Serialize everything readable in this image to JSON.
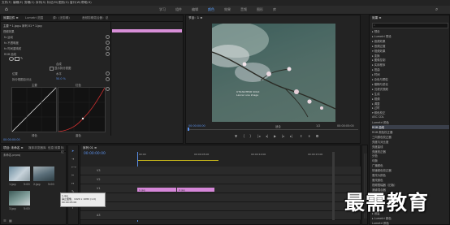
{
  "menu": [
    "文件(F)",
    "编辑(E)",
    "剪辑(C)",
    "序列(S)",
    "标记(M)",
    "图形(G)",
    "窗口(W)",
    "帮助(H)"
  ],
  "workspaces": [
    {
      "label": "学习",
      "active": false
    },
    {
      "label": "组件",
      "active": false
    },
    {
      "label": "编辑",
      "active": false
    },
    {
      "label": "颜色",
      "active": true
    },
    {
      "label": "效果",
      "active": false
    },
    {
      "label": "音频",
      "active": false
    },
    {
      "label": "图形",
      "active": false
    },
    {
      "label": "库",
      "active": false
    }
  ],
  "effect_controls": {
    "tabs": [
      "效果控件 ≡",
      "Lumetri 范围",
      "源：(无剪辑)",
      "音频剪辑混合器：总"
    ],
    "clip_header": "主要 * 1.jpg  ▸  序列 01 * 1.jpg",
    "section": "视频效果",
    "rows": [
      "fx 运动",
      "fx 不透明度",
      "fx 时间重映射"
    ],
    "rgb_curves": "RGB 曲线",
    "dropdown_value": "合成",
    "checkbox_label": "显示拆分视图",
    "position_label": "位置",
    "position_value": "水平",
    "split_label": "拆分视图百分比",
    "split_value": "50.0 %",
    "curve_master_label": "主要",
    "curve_red_label": "红色",
    "bottom_labels": [
      "绿色",
      "蓝色"
    ],
    "timecode": "00:00:00:00"
  },
  "program_monitor": {
    "title": "节目：1 ≡",
    "timecode_left": "00:00:00:00",
    "fit": "适合",
    "ratio": "1/2",
    "timecode_right": "00:00:05:00",
    "watermark": "UTILISATEUR SOLO\nLancer une image"
  },
  "project_panel": {
    "tabs": [
      "项目: 未命名 ≡",
      "媒体浏览器",
      "库",
      "信息",
      "效果",
      "标记"
    ],
    "file_label": "未命名.prproj",
    "clips": [
      {
        "name": "1.jpg",
        "duration": "5:00"
      },
      {
        "name": "2.jpg",
        "duration": "5:00"
      },
      {
        "name": "3.jpg",
        "duration": "5:00"
      }
    ],
    "tooltip": "1.jpg\n静止图像，1920 x 1080 (1.0)\n00:00:05:00"
  },
  "timeline": {
    "tab": "序列 01 ≡",
    "timecode": "00:00:00:00",
    "ruler": [
      "00:00",
      "00:00:05:00",
      "00:00:10:00",
      "00:00:15:00"
    ],
    "tracks": [
      "V3",
      "V2",
      "V1",
      "A1",
      "A2",
      "A3"
    ],
    "clips": [
      {
        "label": "1.jpg",
        "track": "V1"
      },
      {
        "label": "2.jpg",
        "track": "V1"
      }
    ]
  },
  "effects_panel": {
    "title": "效果 ≡",
    "search_placeholder": "",
    "items": [
      "▸ 预设",
      "▸ Lumetri 预设",
      "▸ 音频效果",
      "▸ 音频过渡",
      "▾ 视频效果",
      "  ▸ 变换",
      "  ▸ 图像控制",
      "  ▸ 实用程序",
      "  ▸ 扭曲",
      "  ▸ 时间",
      "  ▸ 杂色与颗粒",
      "  ▸ 模糊与锐化",
      "  ▸ 沉浸式视频",
      "  ▸ 生成",
      "  ▸ 视频",
      "  ▸ 调整",
      "  ▸ 过时",
      "  ▾ 颜色校正",
      "     ASC CDL",
      "     Lumetri 颜色",
      "     RGB 曲线",
      "     RGB 颜色校正器",
      "     三向颜色校正器",
      "     亮度与对比度",
      "     亮度曲线",
      "     亮度校正器",
      "     分色",
      "     均衡",
      "     广播颜色",
      "     快速颜色校正器",
      "     更改为颜色",
      "     更改颜色",
      "     视频限幅器（旧版）",
      "     通道混合器",
      "     颜色平衡",
      "  ▸ 风格化",
      "▸ 视频过渡",
      "▸ 音频",
      "▸ 音量",
      "▸ Lumetri 颜色",
      "Lumetri 颜色"
    ],
    "selected_index": 20
  },
  "watermark_text": "最需教育",
  "colors": {
    "accent": "#5a8fe8",
    "clip": "#d586d8",
    "curve_red": "#d03030",
    "panel_bg": "#232323"
  }
}
